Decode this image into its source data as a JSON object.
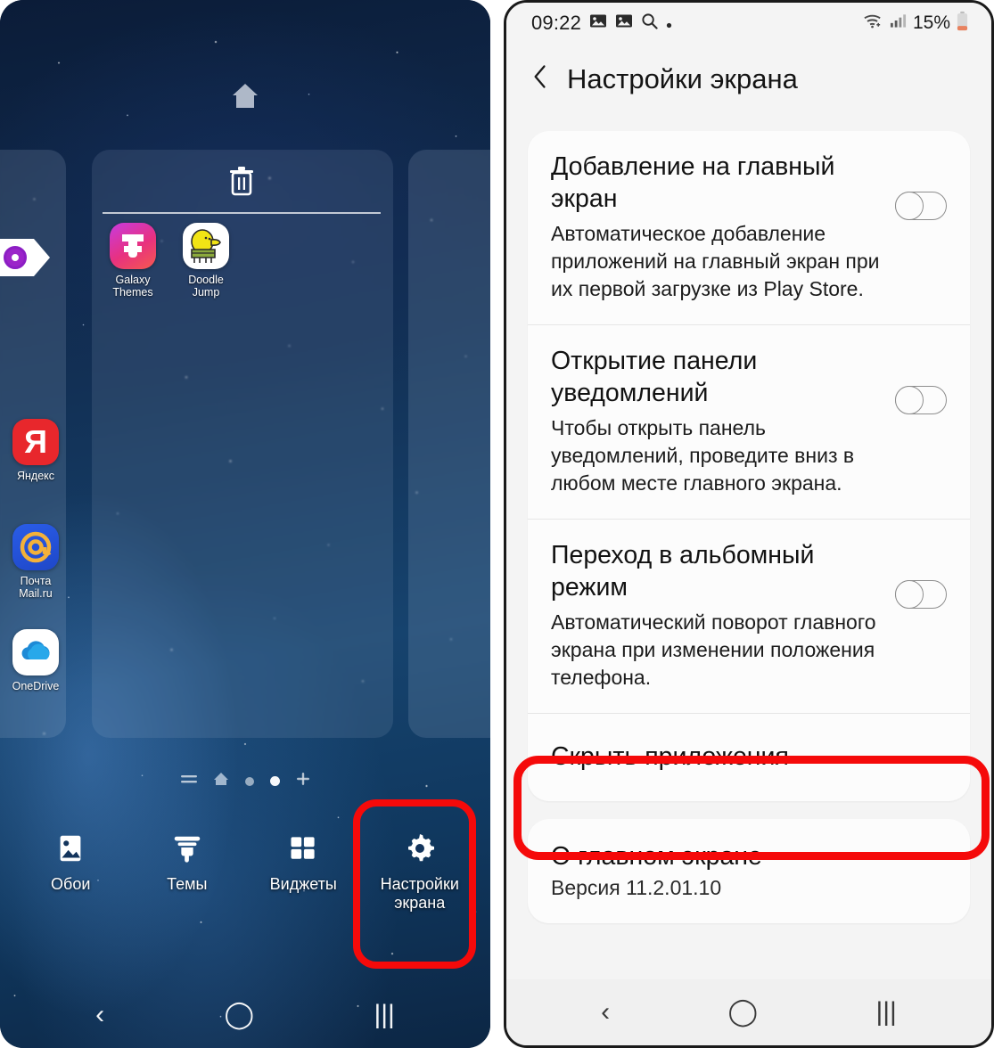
{
  "left_phone": {
    "name": "home-screen-edit-mode",
    "top_icon": "home-icon",
    "page_card_trash": "trash-icon",
    "alice_widget": {
      "icon": "alice-assistant-icon"
    },
    "apps_in_page": [
      {
        "label": "Galaxy\nThemes",
        "label_l1": "Galaxy",
        "label_l2": "Themes",
        "icon": "galaxy-themes-icon"
      },
      {
        "label": "Doodle\nJump",
        "label_l1": "Doodle",
        "label_l2": "Jump",
        "icon": "doodle-jump-icon"
      }
    ],
    "side_apps": [
      {
        "label_l1": "Яндекс",
        "label_l2": "",
        "icon": "yandex-icon",
        "glyph": "Я"
      },
      {
        "label_l1": "Почта",
        "label_l2": "Mail.ru",
        "icon": "mail-ru-icon",
        "glyph": "@"
      },
      {
        "label_l1": "OneDrive",
        "label_l2": "",
        "icon": "onedrive-icon"
      }
    ],
    "page_indicator": {
      "list_icon": "page-list-icon",
      "home_icon": "home-page-icon",
      "dots": [
        {
          "active": false
        },
        {
          "active": true
        }
      ],
      "add_icon": "add-page-icon"
    },
    "toolbar": [
      {
        "label": "Обои",
        "label2": "",
        "icon": "wallpaper-icon",
        "highlighted": false
      },
      {
        "label": "Темы",
        "label2": "",
        "icon": "themes-icon",
        "highlighted": false
      },
      {
        "label": "Виджеты",
        "label2": "",
        "icon": "widgets-icon",
        "highlighted": false
      },
      {
        "label": "Настройки",
        "label2": "экрана",
        "icon": "screen-settings-gear-icon",
        "highlighted": true
      }
    ],
    "navbar": {
      "back": "‹",
      "home": "◯",
      "recents": "|||"
    }
  },
  "right_phone": {
    "statusbar": {
      "time": "09:22",
      "icons_left": [
        "image-icon",
        "image-icon",
        "search-icon",
        "dot-icon"
      ],
      "icons_right": [
        "wifi-icon",
        "signal-icon"
      ],
      "battery_percent": "15%",
      "battery_icon": "battery-low-icon"
    },
    "header": {
      "back_icon": "back-chevron-icon",
      "title": "Настройки экрана"
    },
    "settings": [
      {
        "name": "add-to-home-screen",
        "title": "Добавление на главный экран",
        "subtitle": "Автоматическое добавление приложений на главный экран при их первой загрузке из Play Store.",
        "toggle": "off"
      },
      {
        "name": "open-notification-panel",
        "title": "Открытие панели уведомлений",
        "subtitle": "Чтобы открыть панель уведомлений, проведите вниз в любом месте главного экрана.",
        "toggle": "off"
      },
      {
        "name": "landscape-mode",
        "title": "Переход в альбомный режим",
        "subtitle": "Автоматический поворот главного экрана при изменении положения телефона.",
        "toggle": "off"
      }
    ],
    "hide_apps": {
      "title": "Скрыть приложения",
      "highlighted": true
    },
    "about": {
      "title": "О главном экране",
      "version": "Версия 11.2.01.10"
    },
    "navbar": {
      "back": "‹",
      "home": "◯",
      "recents": "|||"
    }
  },
  "colors": {
    "highlight_red": "#f50a0a",
    "battery_orange": "#e8825f",
    "card_bg": "#fcfcfc",
    "page_bg": "#f4f4f4"
  }
}
